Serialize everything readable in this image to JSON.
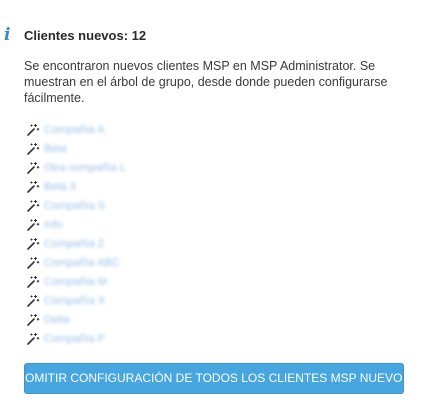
{
  "header": {
    "info_icon": "info-icon",
    "title": "Clientes nuevos: 12"
  },
  "message": "Se encontraron nuevos clientes MSP en MSP Administrator. Se muestran en el árbol de grupo, desde donde pueden configurarse fácilmente.",
  "clients": {
    "item_icon": "magic-wand-icon",
    "link_color": "#9cc2e8",
    "items": [
      "Compañía A",
      "Beta",
      "Otra compañía L",
      "Beta 3",
      "Compañía S",
      "Info",
      "Compañía Z",
      "Compañía ABC",
      "Compañía M",
      "Compañía X",
      "Delta",
      "Compañía P"
    ]
  },
  "actions": {
    "skip_label": "OMITIR CONFIGURACIÓN DE TODOS LOS CLIENTES MSP NUEVOS",
    "accent_color": "#47a6e0"
  }
}
